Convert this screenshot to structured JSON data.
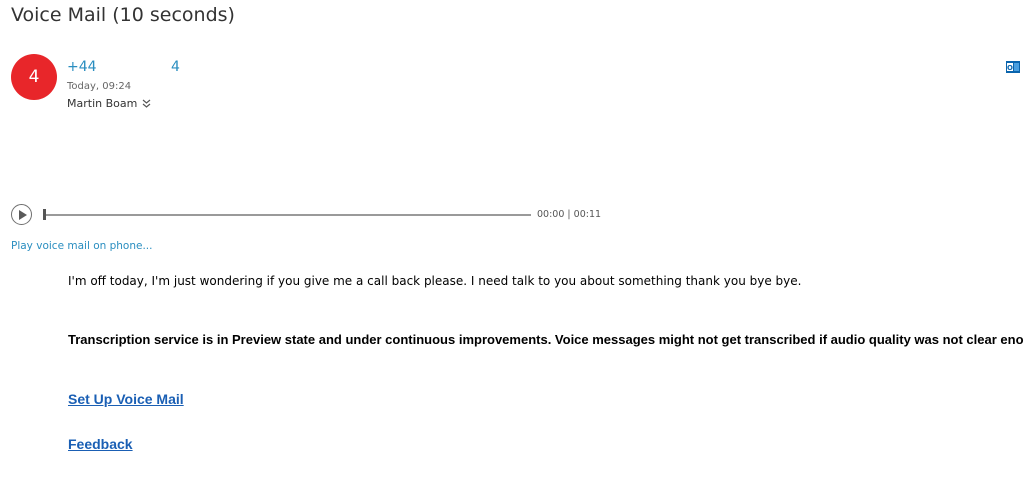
{
  "header": {
    "title": "Voice Mail (10 seconds)"
  },
  "message": {
    "avatar_initial": "4",
    "caller_number": "+44",
    "caller_extra": "4",
    "timestamp": "Today, 09:24",
    "recipient": "Martin Boam",
    "outlook_icon": "outlook-icon"
  },
  "player": {
    "elapsed": "00:00",
    "separator": "|",
    "duration": "00:11",
    "progress": 0
  },
  "actions": {
    "play_on_phone": "Play voice mail on phone..."
  },
  "body": {
    "transcript": "I'm off today, I'm just wondering if you give me a call back please. I need talk to you about something thank you bye bye.",
    "notice": "Transcription service is in Preview state and under continuous improvements. Voice messages might not get transcribed if audio quality was not clear enough."
  },
  "links": {
    "setup": "Set Up Voice Mail",
    "feedback": "Feedback"
  },
  "colors": {
    "avatar": "#e8262a",
    "accent": "#2a8ec0",
    "link": "#1a5fb4"
  }
}
